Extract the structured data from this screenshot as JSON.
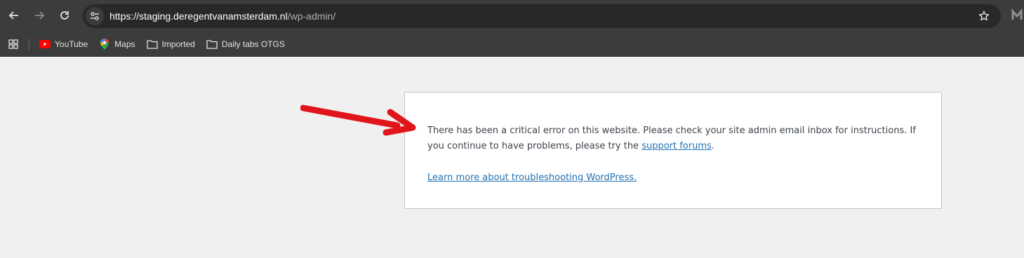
{
  "browser": {
    "url_host": "https://staging.deregentvanamsterdam.nl",
    "url_path": "/wp-admin/",
    "nav": {
      "back_icon": "arrow-left-icon",
      "forward_icon": "arrow-right-icon",
      "reload_icon": "reload-icon"
    },
    "bookmarks": [
      {
        "label": "YouTube",
        "icon": "youtube-icon"
      },
      {
        "label": "Maps",
        "icon": "maps-pin-icon"
      },
      {
        "label": "Imported",
        "icon": "folder-icon"
      },
      {
        "label": "Daily tabs OTGS",
        "icon": "folder-icon"
      }
    ]
  },
  "error": {
    "message_part1": "There has been a critical error on this website. Please check your site admin email inbox for instructions. If you continue to have problems, please try the ",
    "support_link": "support forums",
    "message_end": ".",
    "learn_more_link": "Learn more about troubleshooting WordPress."
  },
  "colors": {
    "chrome_bg": "#3c3c3c",
    "omnibox_bg": "#282828",
    "page_bg": "#f0f0f0",
    "link": "#2271b1",
    "annotation_arrow": "#e0151b"
  }
}
